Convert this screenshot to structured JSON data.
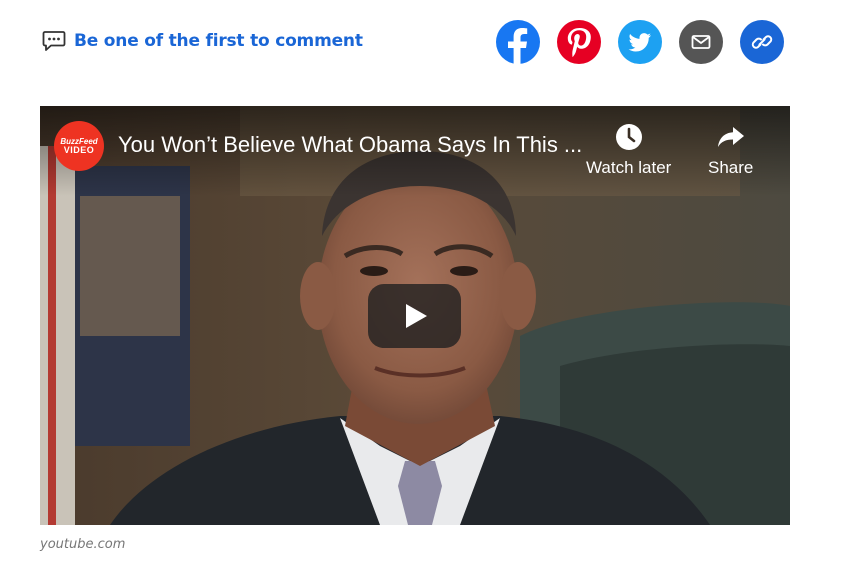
{
  "comment": {
    "label": "Be one of the first to comment",
    "icon": "speech-bubble-icon"
  },
  "share": {
    "items": [
      {
        "name": "facebook",
        "icon": "facebook-icon",
        "color": "#1877f2"
      },
      {
        "name": "pinterest",
        "icon": "pinterest-icon",
        "color": "#e60023"
      },
      {
        "name": "twitter",
        "icon": "twitter-icon",
        "color": "#1da1f2"
      },
      {
        "name": "email",
        "icon": "mail-icon",
        "color": "#555555"
      },
      {
        "name": "copy-link",
        "icon": "link-icon",
        "color": "#1a66d6"
      }
    ]
  },
  "video": {
    "channel_logo_line1": "BuzzFeed",
    "channel_logo_line2": "VIDEO",
    "title": "You Won’t Believe What Obama Says In This ...",
    "watch_later_label": "Watch later",
    "share_label": "Share",
    "play_icon": "play-icon"
  },
  "caption": "youtube.com"
}
